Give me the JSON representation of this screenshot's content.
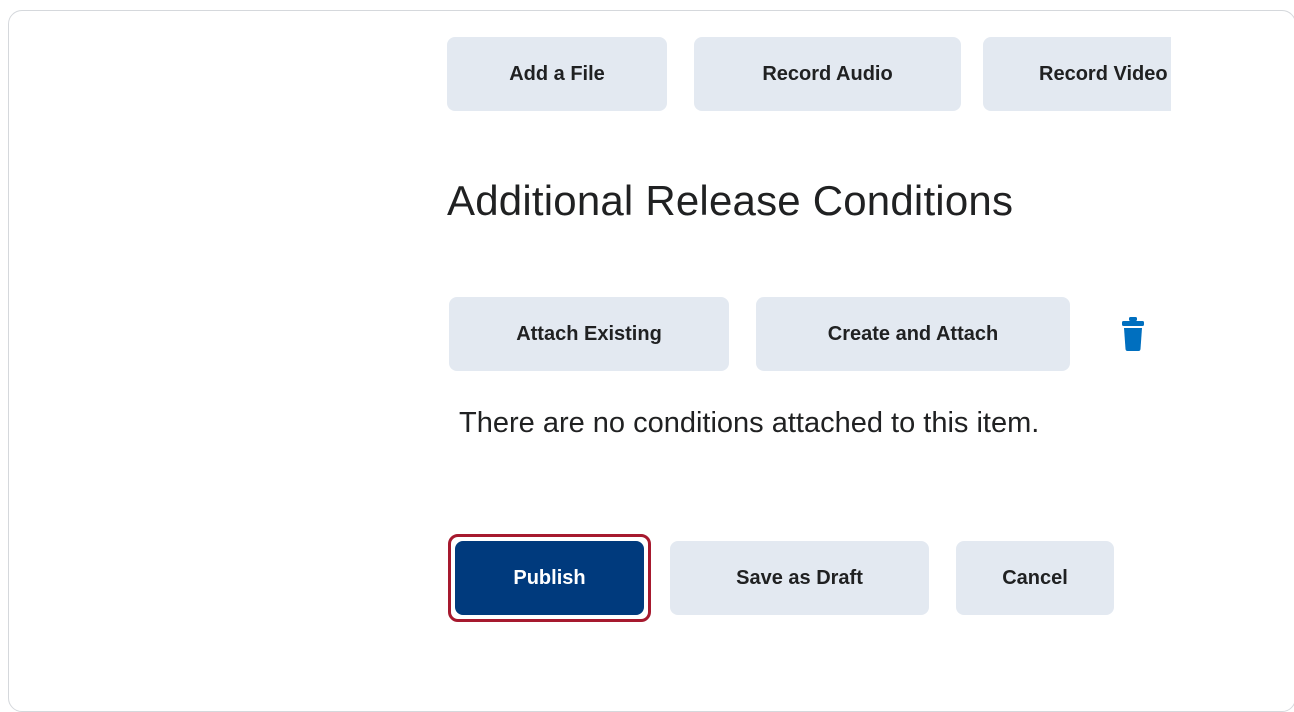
{
  "upload_toolbar": {
    "add_file_label": "Add a File",
    "record_audio_label": "Record Audio",
    "record_video_label": "Record Video"
  },
  "release_conditions": {
    "heading": "Additional Release Conditions",
    "attach_existing_label": "Attach Existing",
    "create_and_attach_label": "Create and Attach",
    "delete_icon": "trash-icon",
    "empty_message": "There are no conditions attached to this item."
  },
  "actions": {
    "publish_label": "Publish",
    "save_draft_label": "Save as Draft",
    "cancel_label": "Cancel"
  },
  "colors": {
    "secondary_button_bg": "#e3e9f1",
    "primary_button_bg": "#003a7d",
    "icon_accent": "#006fbf",
    "highlight_border": "#a6192e",
    "text": "#202122"
  }
}
